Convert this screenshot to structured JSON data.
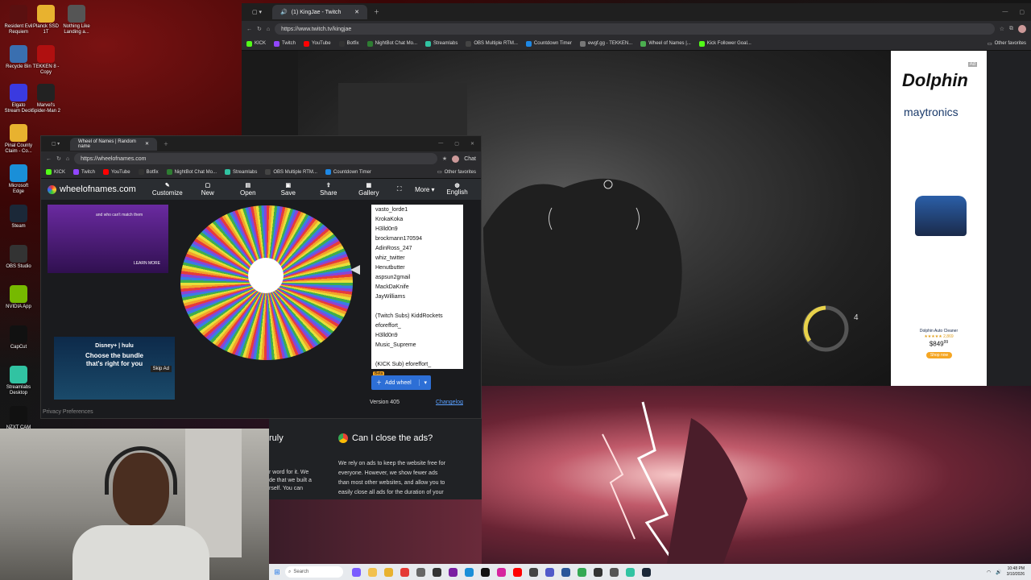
{
  "desktop": {
    "icons": [
      {
        "label": "Resident Evil Requiem",
        "icon": "re-icon",
        "color": "#5a1010"
      },
      {
        "label": "Planck SSD 1T",
        "icon": "folder-icon",
        "color": "#e8b22f"
      },
      {
        "label": "Nothing Like Landing a...",
        "icon": "game-icon",
        "color": "#555555"
      },
      {
        "label": "Recycle Bin",
        "icon": "recycle-bin-icon",
        "color": "#3a6fb0"
      },
      {
        "label": "TEKKEN 8 - Copy",
        "icon": "tekken-icon",
        "color": "#b01010"
      },
      {
        "label": "Elgato Stream Deck",
        "icon": "stream-deck-icon",
        "color": "#3a3ae0"
      },
      {
        "label": "Marvel's Spider-Man 2",
        "icon": "spiderman-icon",
        "color": "#222222"
      },
      {
        "label": "Pinal County Claim - Co...",
        "icon": "folder-icon",
        "color": "#e8b22f"
      },
      {
        "label": "Microsoft Edge",
        "icon": "edge-icon",
        "color": "#1a8fd8"
      },
      {
        "label": "Steam",
        "icon": "steam-icon",
        "color": "#1b2838"
      },
      {
        "label": "OBS Studio",
        "icon": "obs-icon",
        "color": "#333333"
      },
      {
        "label": "NVIDIA App",
        "icon": "nvidia-icon",
        "color": "#76b900"
      },
      {
        "label": "CapCut",
        "icon": "capcut-icon",
        "color": "#111111"
      },
      {
        "label": "Streamlabs Desktop",
        "icon": "streamlabs-icon",
        "color": "#31c3a2"
      },
      {
        "label": "NZXT CAM",
        "icon": "nzxt-icon",
        "color": "#111111"
      }
    ]
  },
  "twitch_browser": {
    "tab_title": "(1) KingJae - Twitch",
    "url": "https://www.twitch.tv/kingjae",
    "bookmarks": [
      "KICK",
      "Twitch",
      "YouTube",
      "Botfix",
      "NightBot Chat Mo...",
      "Streamlabs",
      "OBS Multiple RTM...",
      "Countdown Timer",
      "ewgf.gg - TEKKEN...",
      "Wheel of Names |...",
      "Kick Follower Goal..."
    ],
    "other_favorites": "Other favorites",
    "hud_number": "4",
    "ad": {
      "brand": "Dolphin",
      "company": "maytronics",
      "badge": "Ad",
      "product": "Dolphin Auto Cleaner",
      "rating": "★★★★★ 2,869",
      "price": "$849",
      "price_cents": "99",
      "cta": "Shop now"
    }
  },
  "wheel_window": {
    "tab_title": "Wheel of Names | Random name",
    "url": "https://wheelofnames.com",
    "bookmarks": [
      "KICK",
      "Twitch",
      "YouTube",
      "Botfix",
      "NightBot Chat Mo...",
      "Streamlabs",
      "OBS Multiple RTM...",
      "Countdown Timer"
    ],
    "other_favorites": "Other favorites",
    "chat_label": "Chat",
    "site_name": "wheelofnames.com",
    "menu": [
      "Customize",
      "New",
      "Open",
      "Save",
      "Share",
      "Gallery"
    ],
    "more": "More",
    "language": "English",
    "promo_caption": "and who can't match them",
    "learn_more": "LEARN MORE",
    "ad2": {
      "brand": "Disney+ | hulu",
      "headline": "Choose the bundle that's right for you",
      "skip": "Skip Ad"
    },
    "entries": [
      "vasto_lorde1",
      "KrokaKoka",
      "H3lld0n9",
      "brockmann170594",
      "AdinRoss_247",
      "whiz_twitter",
      "Henutbutter",
      "aspsun2gmail",
      "MackDaKnife",
      "JayWilliams",
      "",
      "(Twitch Subs) KiddRockets",
      "eforeffort_",
      "H3lld0n9",
      "Music_Supreme",
      "",
      "(KICK Sub) eforeffort_"
    ],
    "beta": "Beta",
    "add_wheel": "Add wheel",
    "version": "Version 405",
    "changelog": "Changelog",
    "privacy": "Privacy Preferences"
  },
  "article": {
    "left_heading": "ruly",
    "left_lines": [
      "r word for it. We",
      "de that we built a",
      "rself. You can"
    ],
    "heading": "Can I close the ads?",
    "body": [
      "We rely on ads to keep the website free for",
      "everyone. However, we show fewer ads",
      "than most other websites, and allow you to",
      "easily close all ads for the duration of your"
    ]
  },
  "taskbar": {
    "search_placeholder": "Search",
    "time": "10:48 PM",
    "date": "3/10/2026"
  }
}
